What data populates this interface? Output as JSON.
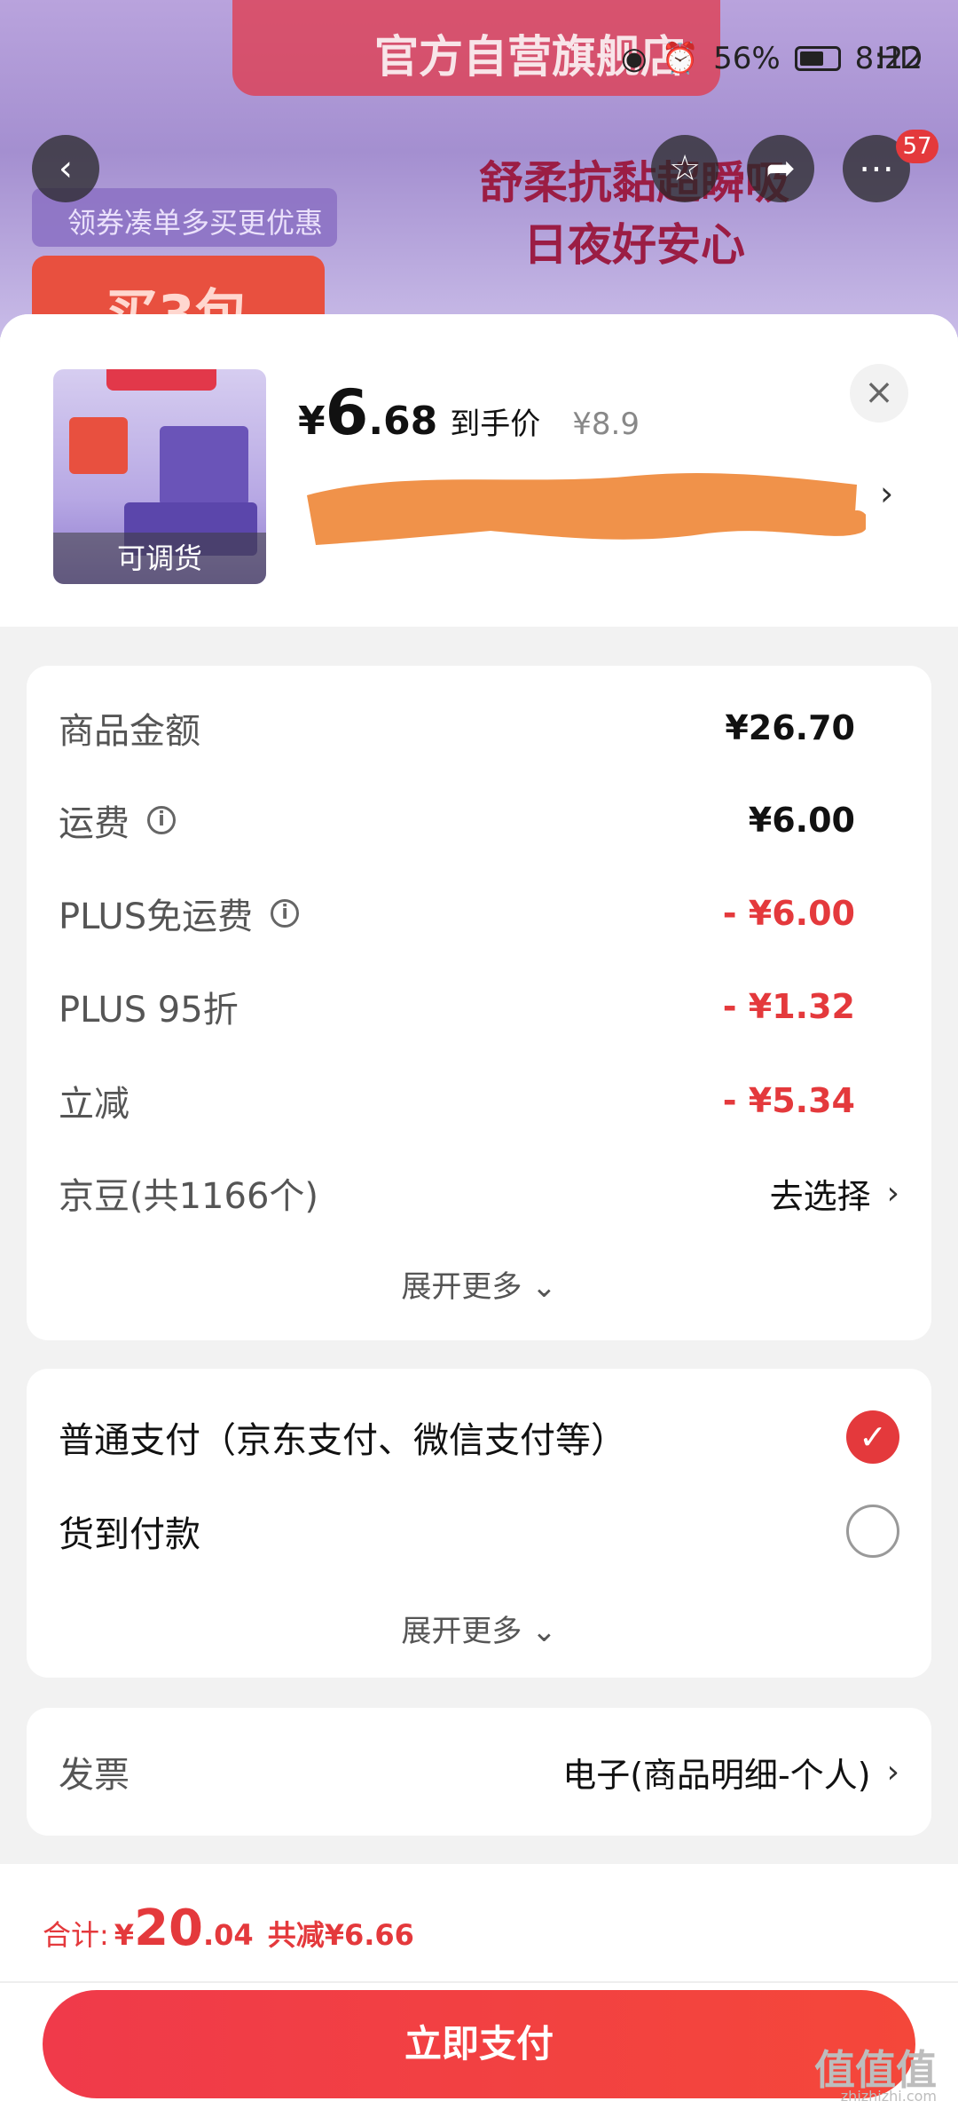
{
  "status_bar": {
    "left_label": "HD",
    "battery": "56%",
    "time": "8:22"
  },
  "background": {
    "store_banner": "官方自营旗舰店",
    "coupon_text": "领券凑单多买更优惠",
    "promo_text": "买3包",
    "slogan_line1": "舒柔抗黏超瞬吸",
    "slogan_line2": "日夜好安心",
    "notification_count": "57"
  },
  "product": {
    "thumbnail_label": "可调货",
    "price_symbol": "¥",
    "price_int": "6",
    "price_dec": ".68",
    "price_label": "到手价",
    "original_price": "¥8.9"
  },
  "summary": {
    "rows": [
      {
        "label": "商品金额",
        "value": "¥26.70",
        "info": false,
        "red": false
      },
      {
        "label": "运费",
        "value": "¥6.00",
        "info": true,
        "red": false
      },
      {
        "label": "PLUS免运费",
        "value": "- ¥6.00",
        "info": true,
        "red": true
      },
      {
        "label": "PLUS 95折",
        "value": "- ¥1.32",
        "info": false,
        "red": true
      },
      {
        "label": "立减",
        "value": "- ¥5.34",
        "info": false,
        "red": true
      }
    ],
    "jingdou_label": "京豆(共1166个)",
    "jingdou_action": "去选择",
    "expand_label": "展开更多"
  },
  "payment": {
    "options": [
      {
        "label": "普通支付（京东支付、微信支付等）",
        "selected": true
      },
      {
        "label": "货到付款",
        "selected": false
      }
    ],
    "expand_label": "展开更多"
  },
  "invoice": {
    "label": "发票",
    "value": "电子(商品明细-个人)"
  },
  "footer": {
    "total_label": "合计:",
    "total_symbol": "¥",
    "total_int": "20",
    "total_dec": ".04",
    "reduced_label": "共减",
    "reduced_value": "¥6.66",
    "pay_button": "立即支付"
  },
  "watermark": {
    "text": "值值值",
    "sub": "zhizhizhi.com"
  },
  "colors": {
    "accent_red": "#e4393c",
    "sheet_bg": "#f2f2f2"
  }
}
